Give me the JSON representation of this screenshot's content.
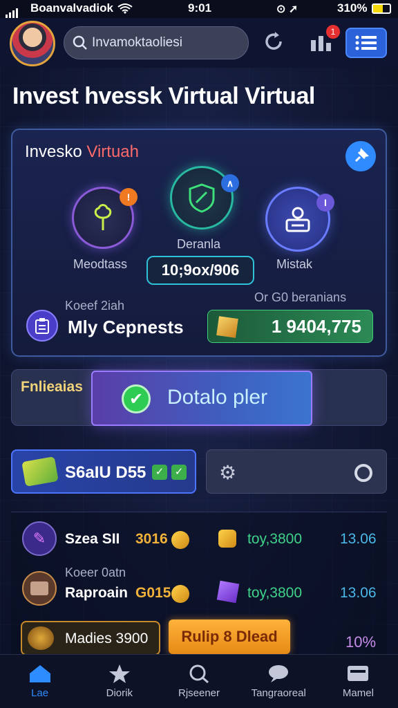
{
  "status_bar": {
    "carrier": "Boanvalvadiok",
    "time": "9:01",
    "battery": "310%"
  },
  "header": {
    "search_value": "Invamoktaoliesi",
    "badge_count": "1"
  },
  "page_title": "Invest hvessk Virtual Virtual",
  "invest_card": {
    "title_white": "Invesko ",
    "title_red": "Virtuah",
    "items": [
      {
        "label": "Meodtass",
        "dot": "!",
        "dot_color": "#f07a22",
        "icon": "plant-icon"
      },
      {
        "label": "Deranla",
        "dot": "∧",
        "dot_color": "#2c6de0",
        "icon": "shield-icon"
      },
      {
        "label": "Mistak",
        "dot": "I",
        "dot_color": "#6a58d8",
        "icon": "profile-icon"
      }
    ],
    "value": "10;9ox/906",
    "caption_right": "Or G0 beranians",
    "caption_left": "Koeef 2iah",
    "my_label": "Mly Cepnests",
    "my_value": "1 9404,775"
  },
  "promo": {
    "label": "Fnlieaias",
    "button": "Dotalo pler"
  },
  "tabs": {
    "active_label": "S6aIU D55"
  },
  "rows": [
    {
      "name": "Szea SII",
      "amount": "3016",
      "value": "toy,3800",
      "change": "13.06"
    },
    {
      "sub": "Koeer 0atn",
      "name": "Raproain",
      "amount": "G015",
      "value": "toy,3800",
      "change": "13.06"
    }
  ],
  "footer_row": {
    "madlies": "Madies 3900",
    "button": "Rulip 8 Dlead",
    "percent": "10%"
  },
  "nav": [
    {
      "label": "Lae",
      "icon": "home-icon"
    },
    {
      "label": "Diorik",
      "icon": "star-icon"
    },
    {
      "label": "Rjseener",
      "icon": "search-icon"
    },
    {
      "label": "Tangraoreal",
      "icon": "chat-icon"
    },
    {
      "label": "Mamel",
      "icon": "card-icon"
    }
  ]
}
